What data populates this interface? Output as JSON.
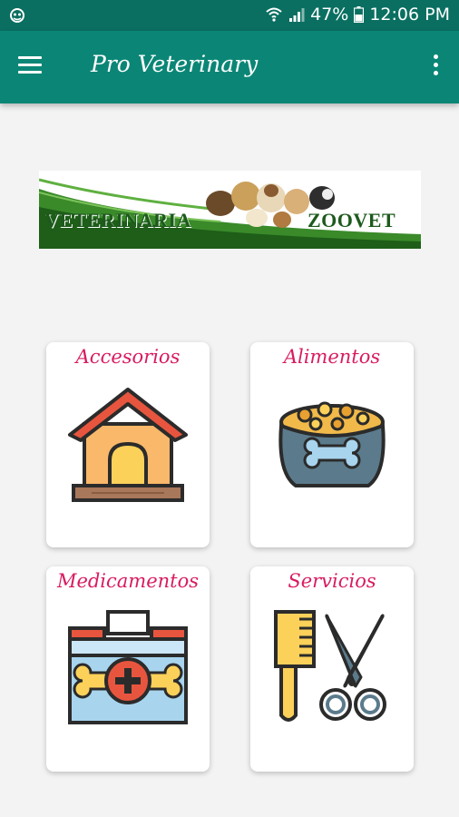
{
  "status_bar": {
    "battery_percent": "47%",
    "time": "12:06 PM",
    "icons": [
      "notification-icon",
      "wifi-icon",
      "signal-icon",
      "battery-icon"
    ]
  },
  "app_bar": {
    "title": "Pro Veterinary",
    "menu_icon": "hamburger-menu-icon",
    "overflow_icon": "more-vert-icon",
    "background_color": "#0b8676",
    "status_color": "#0a6f61"
  },
  "banner": {
    "text_left": "VETERINARIA",
    "text_right": "ZOOVET"
  },
  "categories": [
    {
      "label": "Accesorios",
      "icon": "dog-house-icon"
    },
    {
      "label": "Alimentos",
      "icon": "pet-food-bowl-icon"
    },
    {
      "label": "Medicamentos",
      "icon": "pet-medicine-kit-icon"
    },
    {
      "label": "Servicios",
      "icon": "grooming-comb-scissors-icon"
    }
  ],
  "accent_color": "#d81b60"
}
